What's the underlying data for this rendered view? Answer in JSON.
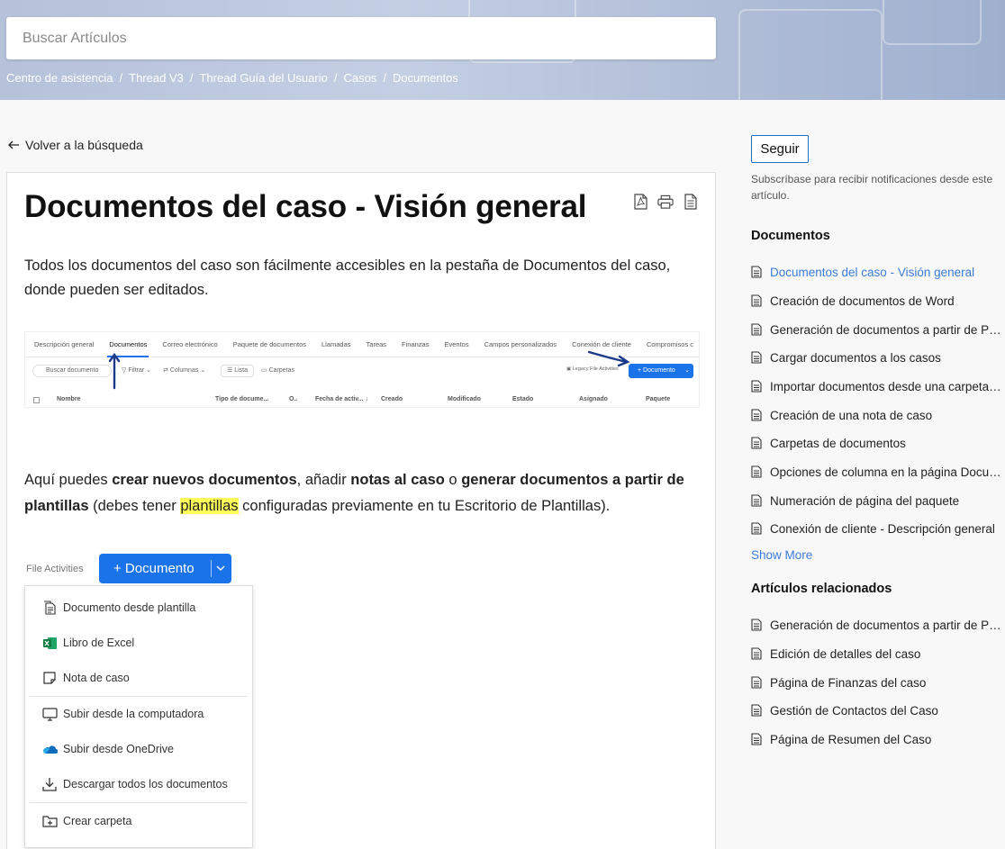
{
  "search": {
    "placeholder": "Buscar Artículos"
  },
  "breadcrumb": [
    "Centro de asistencia",
    "Thread V3",
    "Thread Guía del Usuario",
    "Casos",
    "Documentos"
  ],
  "back_link": "Volver a la búsqueda",
  "article": {
    "title": "Documentos del caso - Visión general",
    "para1": "Todos los documentos del caso son fácilmente accesibles en la pestaña de Documentos del caso, donde pueden ser editados.",
    "para2": {
      "t1": "Aquí puedes ",
      "b1": "crear nuevos documentos",
      "t2": ", añadir ",
      "b2": "notas al caso",
      "t3": " o ",
      "b3": "generar documentos a partir de plantillas",
      "t4": " (debes tener ",
      "hl": "plantillas",
      "t5": " configuradas previamente en tu Escritorio de Plantillas)."
    },
    "tools": [
      "pdf-icon",
      "print-icon",
      "document-icon"
    ]
  },
  "screenshot1": {
    "tabs": [
      "Descripción general",
      "Documentos",
      "Correo electrónico",
      "Paquete de documentos",
      "Llamadas",
      "Tareas",
      "Finanzas",
      "Eventos",
      "Campos personalizados",
      "Conexión de cliente",
      "Compromisos c"
    ],
    "search_placeholder": "Buscar documento",
    "filter": "Filtrar",
    "columns": "Columnas",
    "list": "Lista",
    "folders": "Carpetas",
    "legacy": "Legacy File Activities",
    "new_doc": "+ Documento",
    "headers": [
      "Nombre",
      "Tipo de docume...",
      "O..",
      "Fecha de activ... ↓",
      "Creado",
      "Modificado",
      "Estado",
      "Asignado",
      "Paquete"
    ]
  },
  "screenshot2": {
    "file_activities": "File Activities",
    "doc_button": "+ Documento",
    "menu": [
      {
        "label": "Documento desde plantilla",
        "icon": "template-icon"
      },
      {
        "label": "Libro de Excel",
        "icon": "excel-icon"
      },
      {
        "label": "Nota de caso",
        "icon": "note-icon"
      },
      {
        "label": "Subir desde la computadora",
        "icon": "monitor-icon"
      },
      {
        "label": "Subir desde OneDrive",
        "icon": "onedrive-icon"
      },
      {
        "label": "Descargar todos los documentos",
        "icon": "download-icon"
      },
      {
        "label": "Crear carpeta",
        "icon": "folder-plus-icon"
      }
    ]
  },
  "sidebar": {
    "follow": "Seguir",
    "subscribe_text": "Subscríbase para recibir notificaciones desde este artículo.",
    "section1_title": "Documentos",
    "section1_items": [
      "Documentos del caso - Visión general",
      "Creación de documentos de Word",
      "Generación de documentos a partir de Plantillas",
      "Cargar documentos a los casos",
      "Importar documentos desde una carpeta del sistema",
      "Creación de una nota de caso",
      "Carpetas de documentos",
      "Opciones de columna en la página Documentos",
      "Numeración de página del paquete",
      "Conexión de cliente - Descripción general"
    ],
    "show_more": "Show More",
    "section2_title": "Artículos relacionados",
    "section2_items": [
      "Generación de documentos a partir de Plantillas",
      "Edición de detalles del caso",
      "Página de Finanzas del caso",
      "Gestión de Contactos del Caso",
      "Página de Resumen del Caso"
    ]
  },
  "colors": {
    "accent": "#1a73e8",
    "link": "#3b7dd8",
    "highlight": "#ffff5a"
  }
}
